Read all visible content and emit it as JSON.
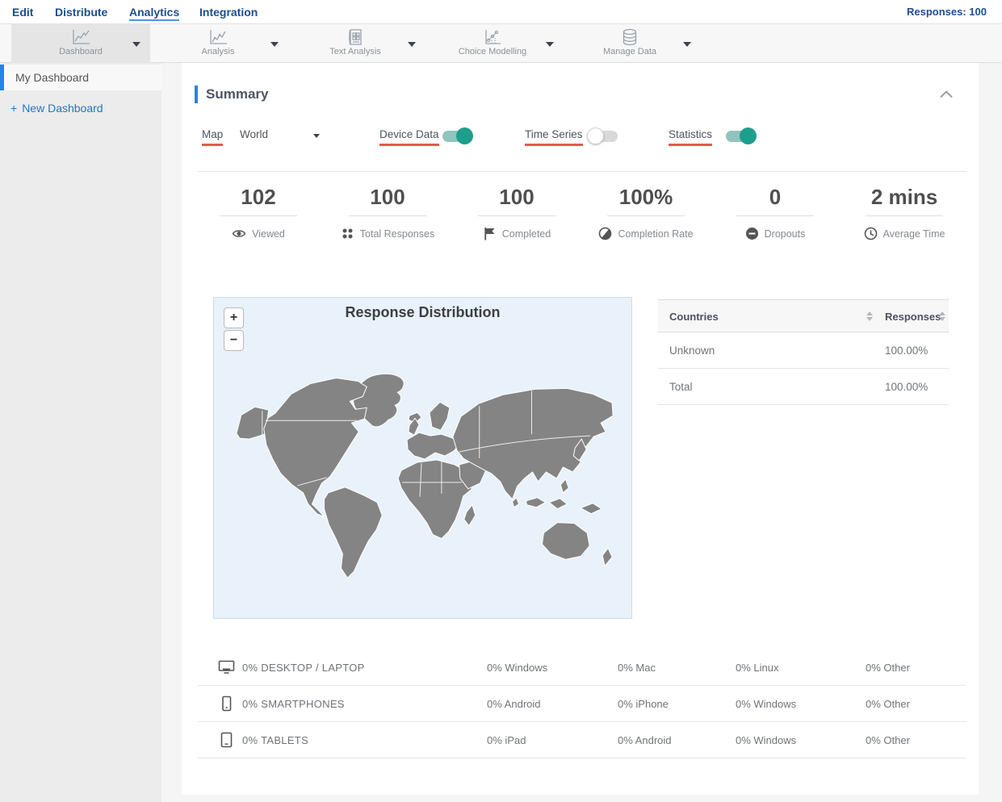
{
  "colors": {
    "accent_blue": "#2186eb",
    "nav_blue": "#1b4e91",
    "underline_red": "#e4584e",
    "toggle_on_teal": "#1e9e8c",
    "map_land_gray": "#848484",
    "map_background": "#e9f2fa"
  },
  "nav": {
    "items": [
      "Edit",
      "Distribute",
      "Analytics",
      "Integration"
    ],
    "active_item": "Analytics",
    "responses_label": "Responses: 100"
  },
  "toolbar": {
    "items": [
      {
        "label": "Dashboard",
        "icon": "line-chart-icon",
        "selected": true
      },
      {
        "label": "Analysis",
        "icon": "line-chart-icon",
        "selected": false
      },
      {
        "label": "Text Analysis",
        "icon": "document-grid-icon",
        "selected": false
      },
      {
        "label": "Choice Modelling",
        "icon": "scatter-line-icon",
        "selected": false
      },
      {
        "label": "Manage Data",
        "icon": "database-icon",
        "selected": false
      }
    ]
  },
  "sidebar": {
    "selected_item": "My Dashboard",
    "new_dashboard": {
      "plus": "+",
      "label": "New Dashboard"
    }
  },
  "summary": {
    "title": "Summary",
    "controls": {
      "map_label": "Map",
      "map_selected_value": "World",
      "toggles": [
        {
          "label": "Device Data",
          "state": "on"
        },
        {
          "label": "Time Series",
          "state": "off"
        },
        {
          "label": "Statistics",
          "state": "on"
        }
      ]
    },
    "stats": [
      {
        "value": "102",
        "label": "Viewed",
        "icon": "eye-icon"
      },
      {
        "value": "100",
        "label": "Total Responses",
        "icon": "dots-grid-icon"
      },
      {
        "value": "100",
        "label": "Completed",
        "icon": "flag-icon"
      },
      {
        "value": "100%",
        "label": "Completion Rate",
        "icon": "contrast-circle-icon"
      },
      {
        "value": "0",
        "label": "Dropouts",
        "icon": "minus-circle-icon"
      },
      {
        "value": "2 mins",
        "label": "Average Time",
        "icon": "clock-icon"
      }
    ],
    "map": {
      "title": "Response Distribution",
      "zoom_in_label": "+",
      "zoom_out_label": "−"
    },
    "countries_table": {
      "col1_header": "Countries",
      "col2_header": "Responses",
      "rows": [
        {
          "country": "Unknown",
          "responses": "100.00%"
        },
        {
          "country": "Total",
          "responses": "100.00%"
        }
      ]
    },
    "device_table": {
      "rows": [
        {
          "icon": "desktop-icon",
          "label": "0% DESKTOP / LAPTOP",
          "cells": [
            "0% Windows",
            "0% Mac",
            "0% Linux",
            "0% Other"
          ]
        },
        {
          "icon": "smartphone-icon",
          "label": "0% SMARTPHONES",
          "cells": [
            "0% Android",
            "0% iPhone",
            "0% Windows",
            "0% Other"
          ]
        },
        {
          "icon": "tablet-icon",
          "label": "0% TABLETS",
          "cells": [
            "0% iPad",
            "0% Android",
            "0% Windows",
            "0% Other"
          ]
        }
      ]
    }
  }
}
